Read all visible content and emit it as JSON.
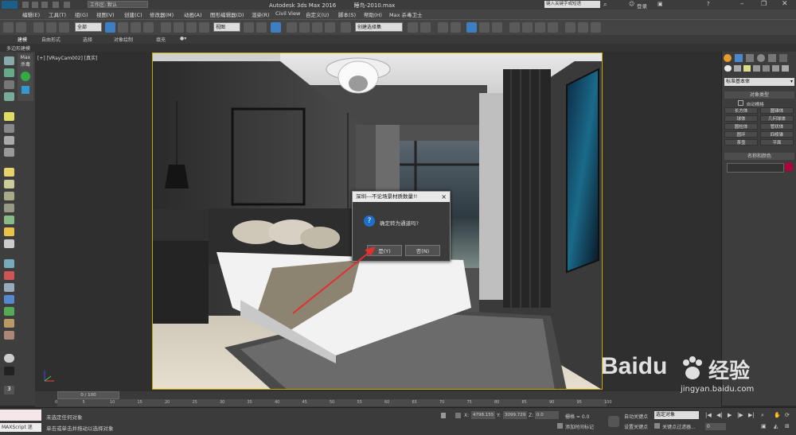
{
  "window": {
    "title": "Autodesk 3ds Max 2016",
    "file": "睡鸟-2010.max",
    "workspace_label": "工作区: 默认",
    "search_placeholder": "键入关键字或短语",
    "login": "登录"
  },
  "menu": [
    "编辑(E)",
    "工具(T)",
    "组(G)",
    "视图(V)",
    "创建(C)",
    "修改器(M)",
    "动画(A)",
    "图形编辑器(D)",
    "渲染(R)",
    "Civil View",
    "自定义(U)",
    "脚本(S)",
    "帮助(H)",
    "Max 杀毒卫士"
  ],
  "toolbar": {
    "selection_filter": "全部",
    "reference_coord": "视图",
    "named_selection": "创建选择集"
  },
  "ribbon": {
    "tabs": [
      "建模",
      "自由形式",
      "选择",
      "对象绘制",
      "填充"
    ],
    "sub_label": "多边形建模"
  },
  "leftpanel": {
    "label_max": "Max",
    "label_kill": "杀毒"
  },
  "viewport": {
    "label": "[+] [VRayCam002] [真实]"
  },
  "dialog": {
    "title": "深圳---不论场景材质数量!!",
    "message": "确定转为通道吗?",
    "yes_button": "是(Y)",
    "no_button": "否(N)",
    "icon_glyph": "?"
  },
  "rightpanel": {
    "category": "标准基本体",
    "section_object_type": "对象类型",
    "autogrid": "自动栅格",
    "buttons": [
      "长方体",
      "圆锥体",
      "球体",
      "几何球体",
      "圆柱体",
      "管状体",
      "圆环",
      "四棱锥",
      "茶壶",
      "平面"
    ],
    "section_name_color": "名称和颜色",
    "name_color_hex": "#b0003a"
  },
  "timeline": {
    "frame_counter": "0 / 100",
    "ticks": [
      "0",
      "5",
      "10",
      "15",
      "20",
      "25",
      "30",
      "35",
      "40",
      "45",
      "50",
      "55",
      "60",
      "65",
      "70",
      "75",
      "80",
      "85",
      "90",
      "95",
      "100"
    ]
  },
  "status": {
    "script_label": "MAXScript 迷",
    "line1": "未选定任何对象",
    "line2": "单击或单击并拖动以选择对象",
    "x_label": "X:",
    "x_value": "4798.155",
    "y_label": "Y:",
    "y_value": "3099.729",
    "z_label": "Z:",
    "z_value": "0.0",
    "grid": "栅格 = 0.0",
    "add_time_tag": "添加时间标记",
    "auto_key": "自动关键点",
    "set_key": "设置关键点",
    "key_filters": "关键点过滤器...",
    "selected_object": "选定对象",
    "frame_value": "0"
  },
  "watermark": {
    "brand": "Baidu",
    "brand_cn": "经验",
    "url": "jingyan.baidu.com"
  },
  "colors": {
    "accent_yellow": "#c9a800",
    "dialog_icon_blue": "#1f6fc8",
    "arrow_red": "#e03030",
    "ui_dark": "#3b3b3b"
  }
}
